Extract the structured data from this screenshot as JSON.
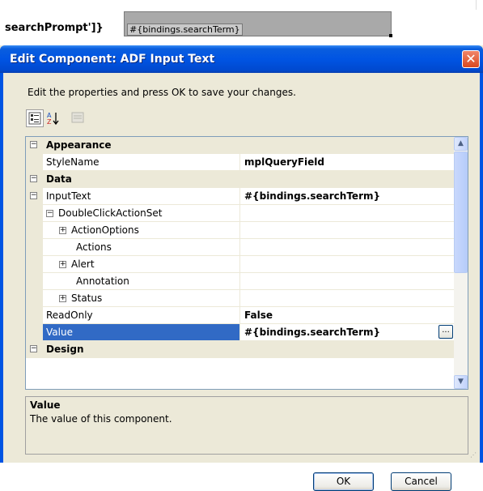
{
  "background": {
    "text": "searchPrompt']}",
    "field_value": "#{bindings.searchTerm}"
  },
  "dialog": {
    "title": "Edit Component: ADF Input Text",
    "close_label": "✕",
    "instruction": "Edit the properties and press OK to save your changes.",
    "toolbar": [
      {
        "name": "categorized-view-icon"
      },
      {
        "name": "alphabetical-sort-icon"
      },
      {
        "name": "property-pages-icon"
      }
    ],
    "properties": [
      {
        "type": "category",
        "label": "Appearance",
        "expanded": true
      },
      {
        "type": "prop",
        "label": "StyleName",
        "value": "mplQueryField",
        "indent": 0
      },
      {
        "type": "category",
        "label": "Data",
        "expanded": true
      },
      {
        "type": "prop",
        "label": "InputText",
        "value": "#{bindings.searchTerm}",
        "indent": 0,
        "toggle": "⊟"
      },
      {
        "type": "prop",
        "label": "DoubleClickActionSet",
        "value": "",
        "indent": 1,
        "toggle": "⊟"
      },
      {
        "type": "prop",
        "label": "ActionOptions",
        "value": "",
        "indent": 2,
        "toggle": "⊞"
      },
      {
        "type": "prop",
        "label": "Actions",
        "value": "",
        "indent": 2
      },
      {
        "type": "prop",
        "label": "Alert",
        "value": "",
        "indent": 2,
        "toggle": "⊞"
      },
      {
        "type": "prop",
        "label": "Annotation",
        "value": "",
        "indent": 2
      },
      {
        "type": "prop",
        "label": "Status",
        "value": "",
        "indent": 2,
        "toggle": "⊞"
      },
      {
        "type": "prop",
        "label": "ReadOnly",
        "value": "False",
        "indent": 0
      },
      {
        "type": "prop",
        "label": "Value",
        "value": "#{bindings.searchTerm}",
        "indent": 0,
        "selected": true,
        "ellipsis": "..."
      },
      {
        "type": "category",
        "label": "Design",
        "expanded": true
      }
    ],
    "description": {
      "title": "Value",
      "text": "The value of this component."
    },
    "buttons": {
      "ok": "OK",
      "cancel": "Cancel"
    }
  }
}
